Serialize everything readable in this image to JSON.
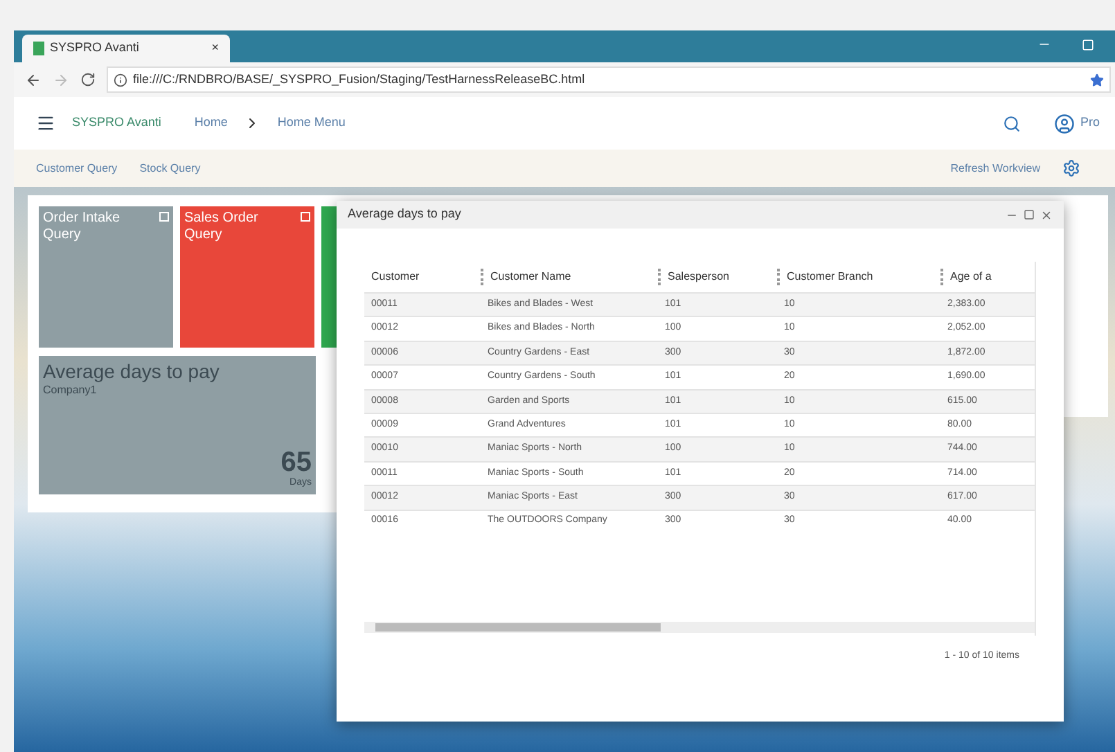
{
  "browser": {
    "tab_title": "SYSPRO Avanti",
    "tab_close": "×",
    "url": "file:///C:/RNDBRO/BASE/_SYSPRO_Fusion/Staging/TestHarnessReleaseBC.html"
  },
  "app": {
    "brand": "SYSPRO Avanti",
    "breadcrumbs": [
      "Home",
      "Home Menu"
    ],
    "user": "Pro"
  },
  "subnav": {
    "links": [
      "Customer Query",
      "Stock Query"
    ],
    "refresh": "Refresh Workview"
  },
  "tiles": [
    {
      "kind": "small",
      "title": "Order Intake Query",
      "color": "#8f9ea3"
    },
    {
      "kind": "small",
      "title": "Sales Order Query",
      "color": "#e8473a"
    },
    {
      "kind": "small",
      "color": "#2fa84f"
    },
    {
      "kind": "kpi",
      "title": "Average days to pay",
      "subtitle": "Company1",
      "value": "65",
      "unit": "Days",
      "color": "#8f9ea3"
    }
  ],
  "dialog": {
    "title": "Average days to pay",
    "columns": [
      "Customer",
      "Customer Name",
      "Salesperson",
      "Customer Branch",
      "Age of a"
    ],
    "rows": [
      [
        "00011",
        "Bikes and Blades - West",
        "101",
        "10",
        "2,383.00"
      ],
      [
        "00012",
        "Bikes and Blades - North",
        "100",
        "10",
        "2,052.00"
      ],
      [
        "00006",
        "Country Gardens - East",
        "300",
        "30",
        "1,872.00"
      ],
      [
        "00007",
        "Country Gardens - South",
        "101",
        "20",
        "1,690.00"
      ],
      [
        "00008",
        "Garden and Sports",
        "101",
        "10",
        "615.00"
      ],
      [
        "00009",
        "Grand Adventures",
        "101",
        "10",
        "80.00"
      ],
      [
        "00010",
        "Maniac Sports - North",
        "100",
        "10",
        "744.00"
      ],
      [
        "00011",
        "Maniac Sports - South",
        "101",
        "20",
        "714.00"
      ],
      [
        "00012",
        "Maniac Sports - East",
        "300",
        "30",
        "617.00"
      ],
      [
        "00016",
        "The OUTDOORS Company",
        "300",
        "30",
        "40.00"
      ]
    ],
    "pager": "1 - 10 of 10 items"
  }
}
